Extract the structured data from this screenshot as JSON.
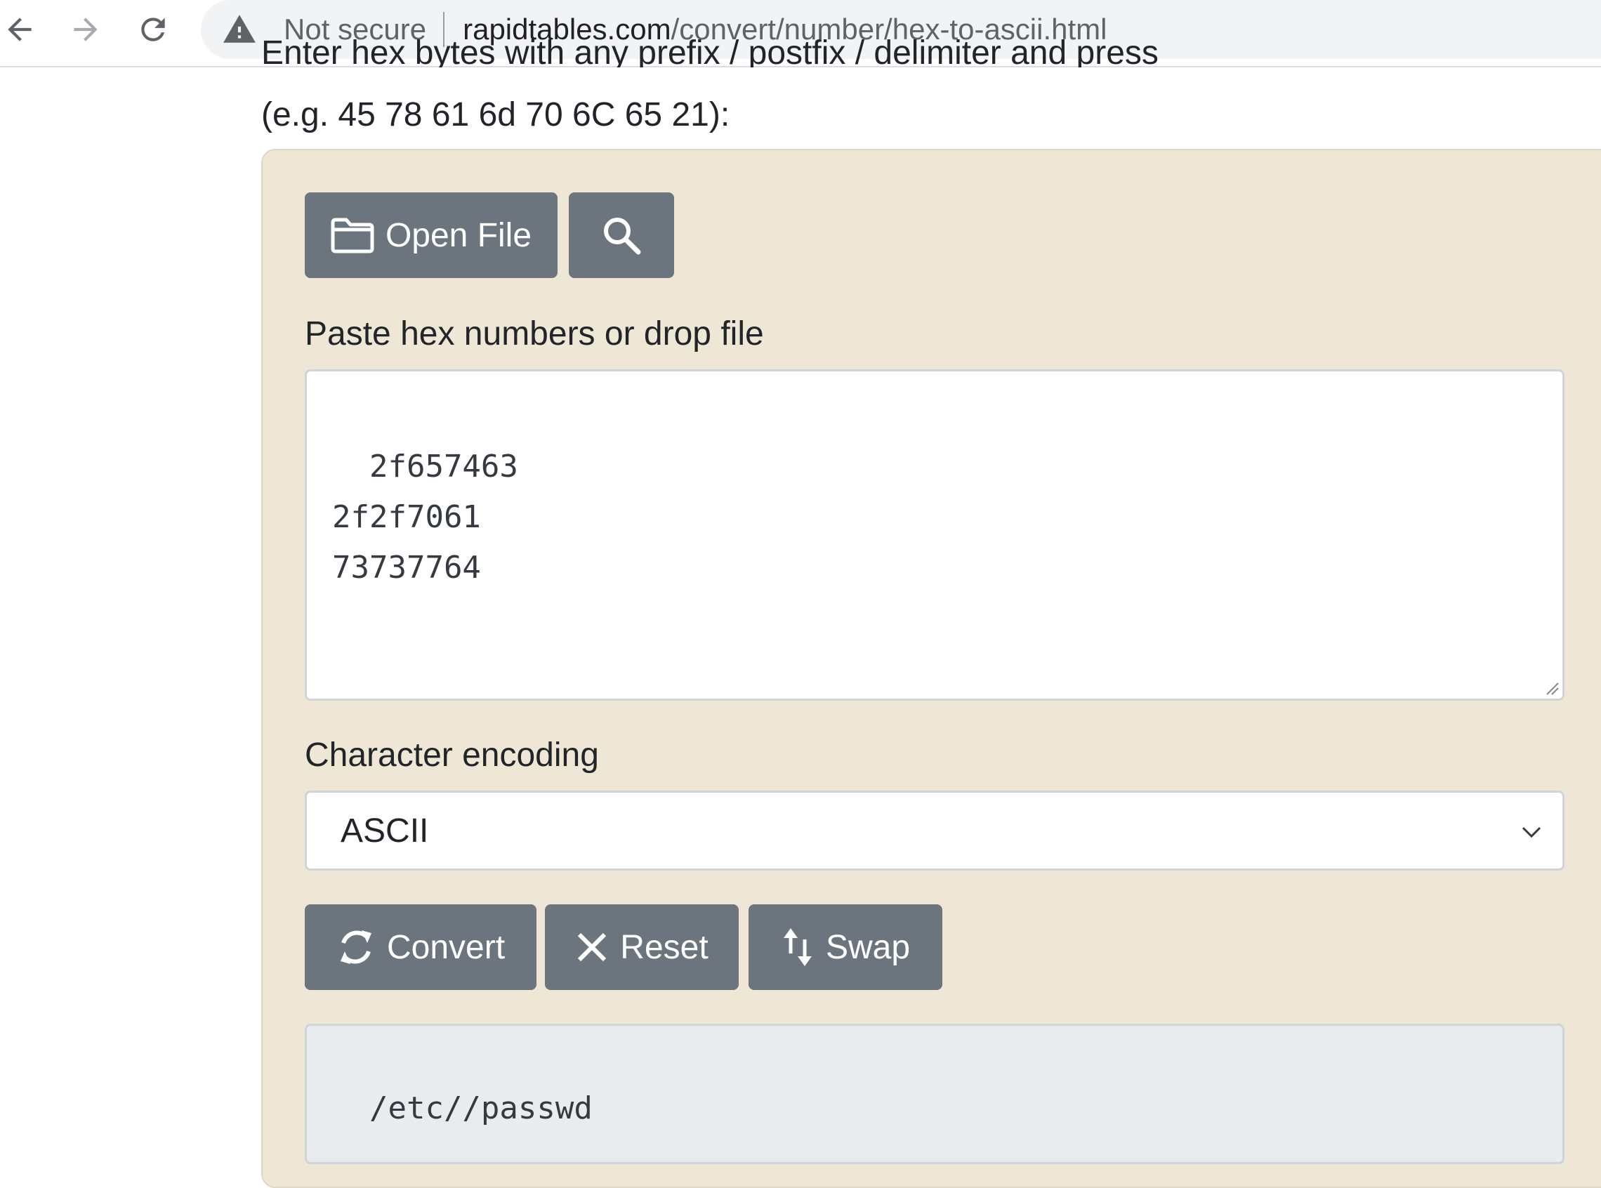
{
  "browser": {
    "security_label": "Not secure",
    "url_domain": "rapidtables.com",
    "url_path": "/convert/number/hex-to-ascii.html"
  },
  "page": {
    "clipped_instruction": "Enter hex bytes with any prefix / postfix / delimiter and press",
    "example": "(e.g. 45 78 61 6d 70 6C 65 21):"
  },
  "form": {
    "open_file_label": "Open File",
    "input_label": "Paste hex numbers or drop file",
    "input_value": "2f657463\n2f2f7061\n73737764",
    "encoding_label": "Character encoding",
    "encoding_selected": "ASCII",
    "convert_label": "Convert",
    "reset_label": "Reset",
    "swap_label": "Swap",
    "output_value": "/etc//passwd"
  },
  "colors": {
    "panel_bg": "#efe7d5",
    "button_bg": "#6c757d",
    "output_bg": "#e9ecef"
  }
}
